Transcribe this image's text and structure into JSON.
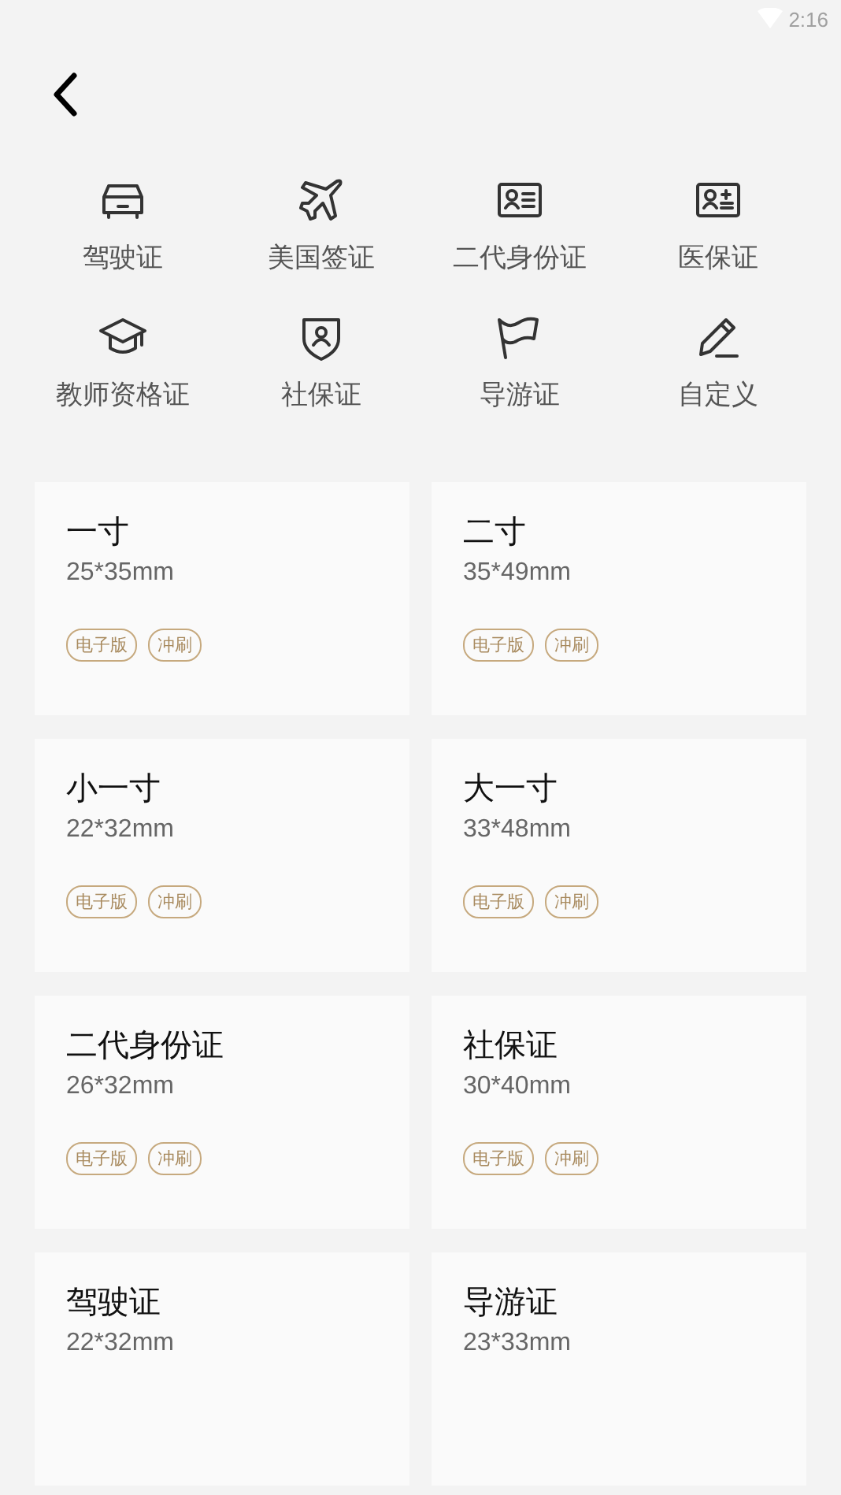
{
  "status_bar": {
    "time": "2:16"
  },
  "categories": [
    {
      "label": "驾驶证"
    },
    {
      "label": "美国签证"
    },
    {
      "label": "二代身份证"
    },
    {
      "label": "医保证"
    },
    {
      "label": "教师资格证"
    },
    {
      "label": "社保证"
    },
    {
      "label": "导游证"
    },
    {
      "label": "自定义"
    }
  ],
  "sizes": [
    {
      "title": "一寸",
      "dimensions": "25*35mm",
      "tags": [
        "电子版",
        "冲刷"
      ]
    },
    {
      "title": "二寸",
      "dimensions": "35*49mm",
      "tags": [
        "电子版",
        "冲刷"
      ]
    },
    {
      "title": "小一寸",
      "dimensions": "22*32mm",
      "tags": [
        "电子版",
        "冲刷"
      ]
    },
    {
      "title": "大一寸",
      "dimensions": "33*48mm",
      "tags": [
        "电子版",
        "冲刷"
      ]
    },
    {
      "title": "二代身份证",
      "dimensions": "26*32mm",
      "tags": [
        "电子版",
        "冲刷"
      ]
    },
    {
      "title": "社保证",
      "dimensions": "30*40mm",
      "tags": [
        "电子版",
        "冲刷"
      ]
    },
    {
      "title": "驾驶证",
      "dimensions": "22*32mm"
    },
    {
      "title": "导游证",
      "dimensions": "23*33mm"
    }
  ]
}
